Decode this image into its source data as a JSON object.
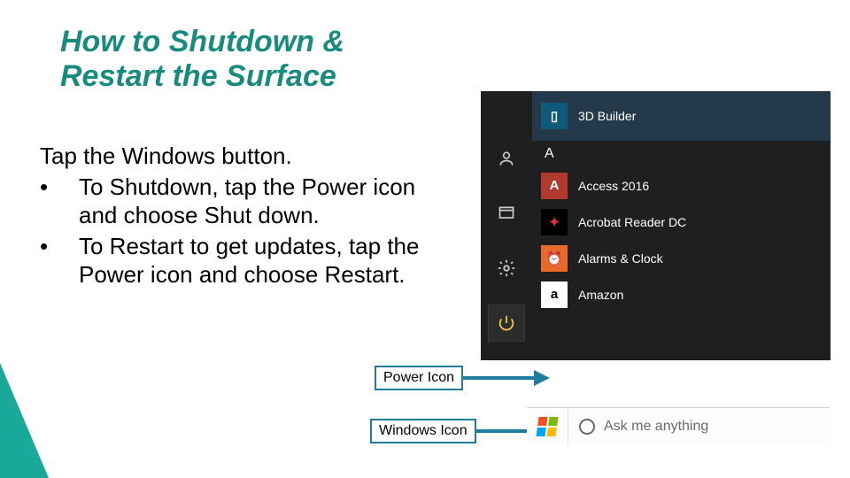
{
  "slide": {
    "title": "How to Shutdown & Restart the Surface",
    "lead": "Tap the Windows button.",
    "bullets": [
      "To Shutdown, tap the Power icon and choose Shut down.",
      "To Restart to get updates, tap the Power icon and choose Restart."
    ]
  },
  "callouts": {
    "power": "Power Icon",
    "windows": "Windows Icon"
  },
  "startmenu": {
    "section_letter": "A",
    "items": [
      {
        "label": "3D Builder",
        "tile_bg": "#0f5a7a",
        "glyph": "▯"
      },
      {
        "label": "Access 2016",
        "tile_bg": "#b03a2e",
        "glyph": "A"
      },
      {
        "label": "Acrobat Reader DC",
        "tile_bg": "#000000",
        "glyph": "✦"
      },
      {
        "label": "Alarms & Clock",
        "tile_bg": "#e86a2b",
        "glyph": "⏰"
      },
      {
        "label": "Amazon",
        "tile_bg": "#ffffff",
        "glyph": "a"
      }
    ],
    "rail": {
      "user": "user-icon",
      "explorer": "file-explorer-icon",
      "settings": "settings-icon",
      "power": "power-icon"
    }
  },
  "taskbar": {
    "search_placeholder": "Ask me anything"
  }
}
